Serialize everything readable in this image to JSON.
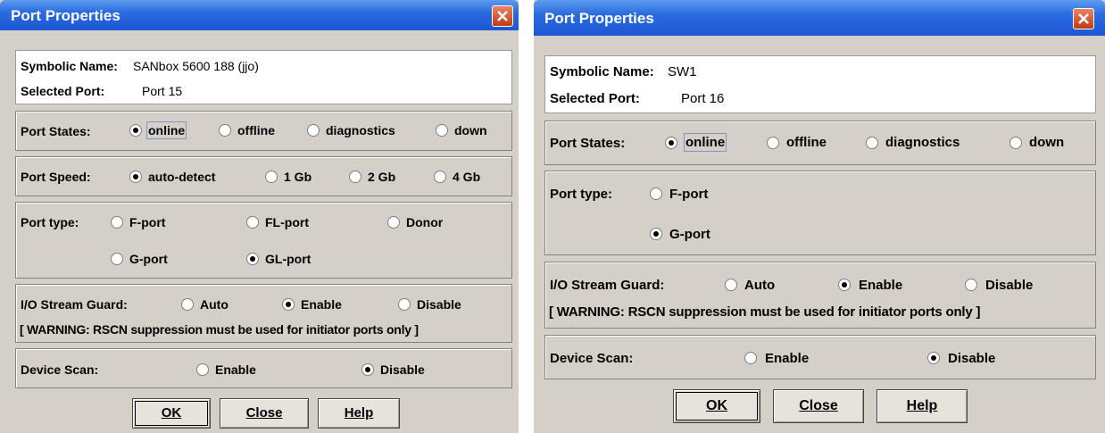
{
  "dialog1": {
    "title": "Port Properties",
    "symbolic_name_label": "Symbolic Name:",
    "symbolic_name_value": "SANbox 5600 188 (jjo)",
    "selected_port_label": "Selected Port:",
    "selected_port_value": "Port 15",
    "port_states": {
      "label": "Port States:",
      "options": [
        "online",
        "offline",
        "diagnostics",
        "down"
      ],
      "selected": "online"
    },
    "port_speed": {
      "label": "Port Speed:",
      "options": [
        "auto-detect",
        "1 Gb",
        "2 Gb",
        "4 Gb"
      ],
      "selected": "auto-detect"
    },
    "port_type": {
      "label": "Port type:",
      "options": [
        "F-port",
        "FL-port",
        "Donor",
        "G-port",
        "GL-port"
      ],
      "selected": "GL-port"
    },
    "io_stream_guard": {
      "label": "I/O Stream Guard:",
      "options": [
        "Auto",
        "Enable",
        "Disable"
      ],
      "selected": "Enable"
    },
    "warning": "[ WARNING: RSCN suppression must be used for initiator ports only ]",
    "device_scan": {
      "label": "Device Scan:",
      "options": [
        "Enable",
        "Disable"
      ],
      "selected": "Disable"
    },
    "buttons": {
      "ok": "OK",
      "close": "Close",
      "help": "Help"
    }
  },
  "dialog2": {
    "title": "Port Properties",
    "symbolic_name_label": "Symbolic Name:",
    "symbolic_name_value": "SW1",
    "selected_port_label": "Selected Port:",
    "selected_port_value": "Port 16",
    "port_states": {
      "label": "Port States:",
      "options": [
        "online",
        "offline",
        "diagnostics",
        "down"
      ],
      "selected": "online"
    },
    "port_type": {
      "label": "Port type:",
      "options": [
        "F-port",
        "G-port"
      ],
      "selected": "G-port"
    },
    "io_stream_guard": {
      "label": "I/O Stream Guard:",
      "options": [
        "Auto",
        "Enable",
        "Disable"
      ],
      "selected": "Enable"
    },
    "warning": "[ WARNING: RSCN suppression must be used for initiator ports only ]",
    "device_scan": {
      "label": "Device Scan:",
      "options": [
        "Enable",
        "Disable"
      ],
      "selected": "Disable"
    },
    "buttons": {
      "ok": "OK",
      "close": "Close",
      "help": "Help"
    }
  },
  "colors": {
    "titlebar": "#1c56d3",
    "dialog_bg": "#d4d0c8",
    "close_button": "#c23a18"
  }
}
